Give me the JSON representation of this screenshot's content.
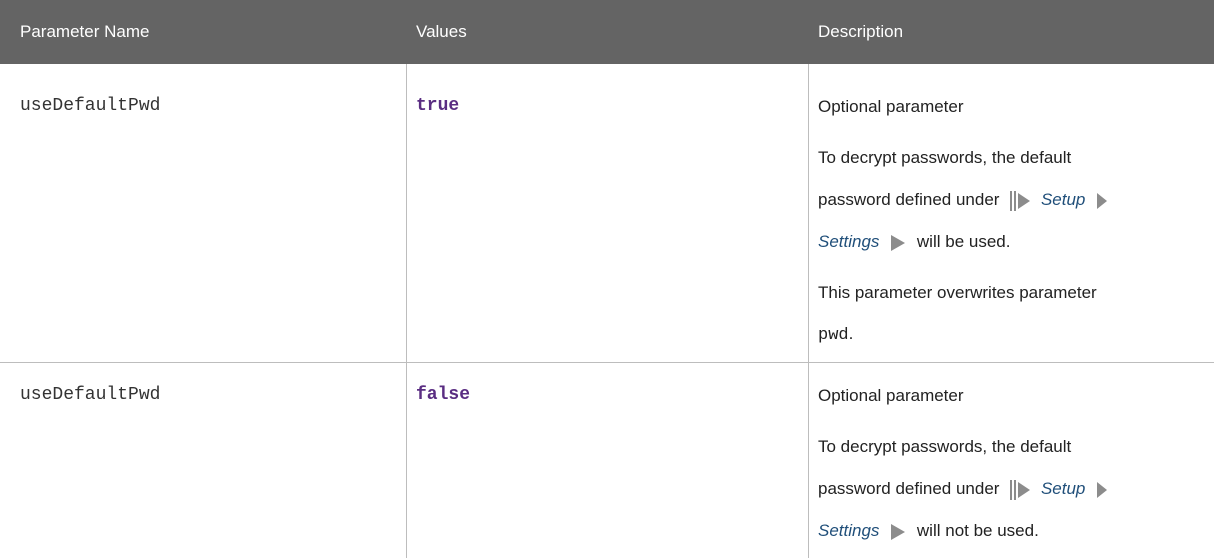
{
  "table": {
    "headers": {
      "name": "Parameter Name",
      "values": "Values",
      "description": "Description"
    },
    "rows": [
      {
        "name": "useDefaultPwd",
        "value": "true",
        "desc": {
          "line1": "Optional parameter",
          "line2": "To decrypt passwords, the default",
          "line3_prefix": "password defined under",
          "menu1": "Setup",
          "menu2": "Settings",
          "line4_suffix": "will be used.",
          "line5": "This parameter overwrites parameter",
          "line6_code": "pwd",
          "line6_suffix": "."
        }
      },
      {
        "name": "useDefaultPwd",
        "value": "false",
        "desc": {
          "line1": "Optional parameter",
          "line2": "To decrypt passwords, the default",
          "line3_prefix": "password defined under",
          "menu1": "Setup",
          "menu2": "Settings",
          "line4_suffix": "will not be used."
        }
      }
    ]
  },
  "colors": {
    "header_bg": "#646464",
    "value_color": "#5a2d82",
    "menu_color": "#1f4e79",
    "arrow_color": "#8c8c8c"
  },
  "icons": [
    "menu-path-start-icon",
    "menu-path-arrow-icon"
  ]
}
